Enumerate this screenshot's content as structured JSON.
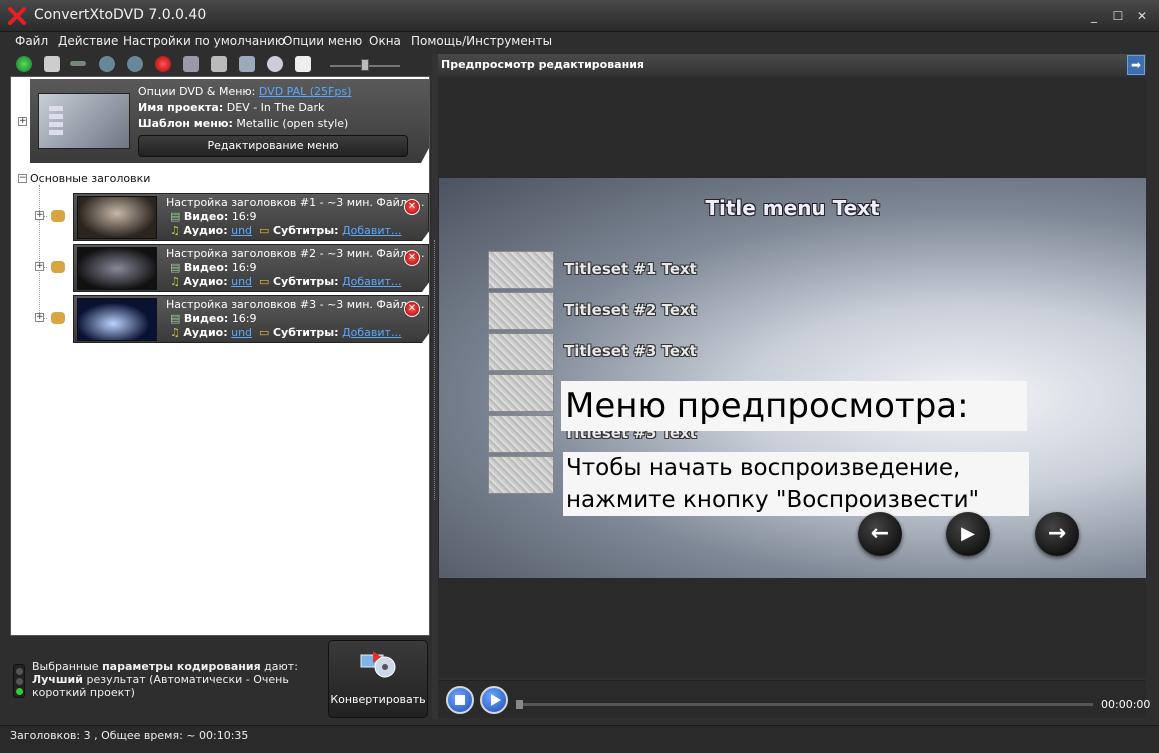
{
  "window": {
    "title": "ConvertXtoDVD 7.0.0.40",
    "minimize": "_",
    "maximize": "☐",
    "close": "✕"
  },
  "menubar": {
    "items": [
      "Файл",
      "Действие",
      "Настройки по умолчанию",
      "Опции меню",
      "Окна",
      "Помощь/Инструменты"
    ]
  },
  "toolbar": {
    "icons": [
      "add-icon",
      "save-icon",
      "disabled-icon",
      "move-down-icon",
      "move-up-icon",
      "delete-icon",
      "settings-icon",
      "film-icon",
      "monitor-icon",
      "disc-icon",
      "document-icon"
    ]
  },
  "menu_card": {
    "line1_label": "Опции DVD & Меню:",
    "line1_link": "DVD PAL (25Fps)",
    "line2_label": "Имя проекта:",
    "line2_value": "DEV - In The Dark",
    "line3_label": "Шаблон меню:",
    "line3_value": "Metallic (open style)",
    "edit_button": "Редактирование меню"
  },
  "tree": {
    "main_titles_label": "Основные заголовки"
  },
  "titles": [
    {
      "heading": "Настройка заголовков #1 - ~3 мин. Файл: ...",
      "video_label": "Видео:",
      "video_value": "16:9",
      "audio_label": "Аудио:",
      "audio_link": "und",
      "subs_label": "Субтитры:",
      "subs_link": "Добавит..."
    },
    {
      "heading": "Настройка заголовков #2 - ~3 мин. Файл: ...",
      "video_label": "Видео:",
      "video_value": "16:9",
      "audio_label": "Аудио:",
      "audio_link": "und",
      "subs_label": "Субтитры:",
      "subs_link": "Добавит..."
    },
    {
      "heading": "Настройка заголовков #3 - ~3 мин. Файл: ...",
      "video_label": "Видео:",
      "video_value": "16:9",
      "audio_label": "Аудио:",
      "audio_link": "und",
      "subs_label": "Субтитры:",
      "subs_link": "Добавит..."
    }
  ],
  "encoding": {
    "part1": "Выбранные ",
    "part2": "параметры кодирования",
    "part3": " дают: ",
    "part4": "Лучший",
    "part5": " результат (Автоматически - Очень короткий проект)"
  },
  "convert_button": "Конвертировать",
  "preview": {
    "header": "Предпросмотр редактирования",
    "arrow_icon": "➡",
    "menu_title": "Title menu Text",
    "titleset_texts": [
      "Titleset #1 Text",
      "Titleset #2 Text",
      "Titleset #3 Text",
      "",
      "Titleset #5 Text",
      ""
    ],
    "overlay_title": "Меню предпросмотра:",
    "overlay_line1": "Чтобы начать воспроизведение,",
    "overlay_line2": "нажмите кнопку \"Воспроизвести\""
  },
  "player": {
    "time": "00:00:00"
  },
  "status": {
    "text": "Заголовков: 3 , Общее время: ~ 00:10:35"
  }
}
